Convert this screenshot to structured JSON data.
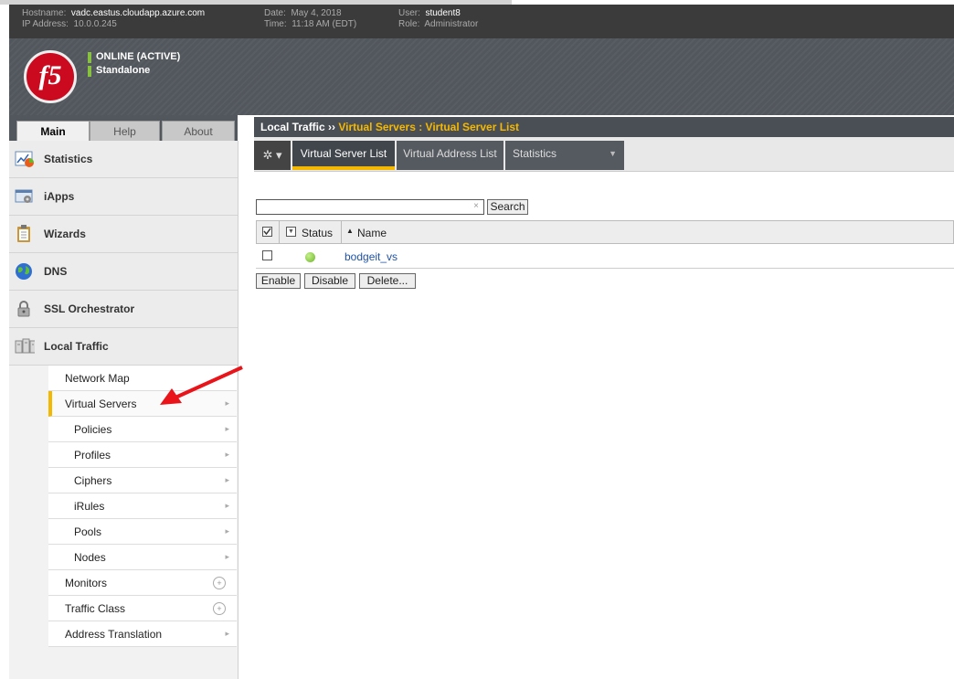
{
  "banner": {
    "hostname_label": "Hostname:",
    "hostname": "vadc.eastus.cloudapp.azure.com",
    "ip_label": "IP Address:",
    "ip": "10.0.0.245",
    "date_label": "Date:",
    "date": "May 4, 2018",
    "time_label": "Time:",
    "time": "11:18 AM (EDT)",
    "user_label": "User:",
    "user": "student8",
    "role_label": "Role:",
    "role": "Administrator"
  },
  "header": {
    "logo_text": "f5",
    "status": "ONLINE (ACTIVE)",
    "mode": "Standalone"
  },
  "tabs": [
    "Main",
    "Help",
    "About"
  ],
  "sidebar": {
    "sections": [
      {
        "label": "Statistics",
        "icon": "chart-icon"
      },
      {
        "label": "iApps",
        "icon": "apps-icon"
      },
      {
        "label": "Wizards",
        "icon": "clipboard-icon"
      },
      {
        "label": "DNS",
        "icon": "globe-icon"
      },
      {
        "label": "SSL Orchestrator",
        "icon": "lock-icon"
      },
      {
        "label": "Local Traffic",
        "icon": "servers-icon"
      }
    ],
    "sub_items": [
      {
        "label": "Network Map"
      },
      {
        "label": "Virtual Servers"
      },
      {
        "label": "Policies"
      },
      {
        "label": "Profiles"
      },
      {
        "label": "Ciphers"
      },
      {
        "label": "iRules"
      },
      {
        "label": "Pools"
      },
      {
        "label": "Nodes"
      },
      {
        "label": "Monitors"
      },
      {
        "label": "Traffic Class"
      },
      {
        "label": "Address Translation"
      }
    ]
  },
  "breadcrumb": {
    "root": "Local Traffic",
    "separator": "››",
    "current": "Virtual Servers : Virtual Server List"
  },
  "subnav": {
    "items": [
      "Virtual Server List",
      "Virtual Address List",
      "Statistics"
    ]
  },
  "search": {
    "value": "",
    "clear": "×",
    "button": "Search"
  },
  "table": {
    "columns": [
      "Status",
      "Name"
    ],
    "rows": [
      {
        "status": "available",
        "name": "bodgeit_vs"
      }
    ]
  },
  "actions": [
    "Enable",
    "Disable",
    "Delete..."
  ],
  "colors": {
    "accent": "#f5b800",
    "status_ok": "#6bb52a",
    "brand_red": "#cc0a1f",
    "annotation_arrow": "#e8141a"
  }
}
